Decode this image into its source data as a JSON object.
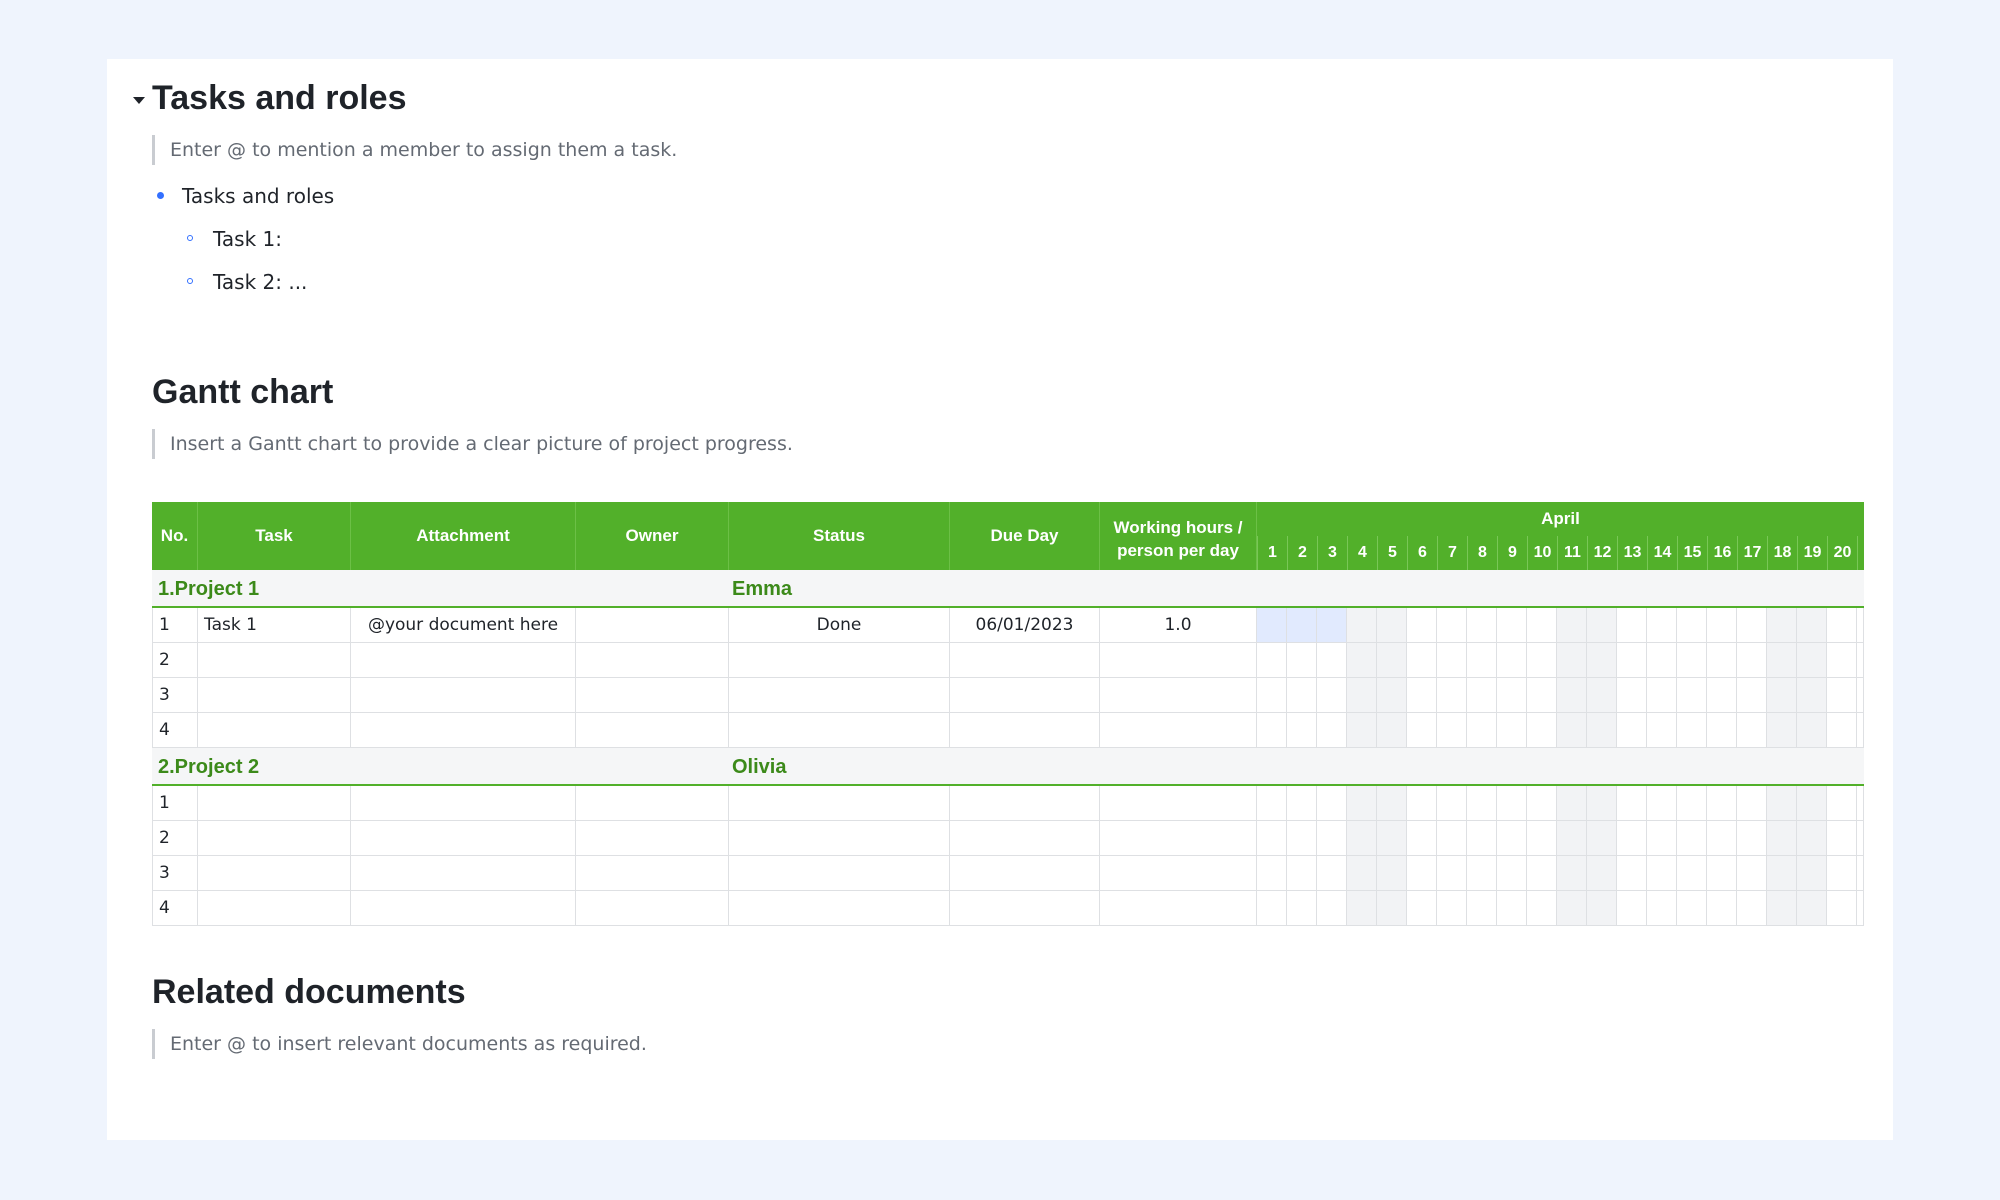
{
  "sections": {
    "tasks": {
      "title": "Tasks and roles",
      "hint": "Enter @ to mention a member to assign them a task.",
      "bullet": "Tasks and roles",
      "subitems": [
        "Task 1:",
        "Task 2: ..."
      ]
    },
    "gantt": {
      "title": "Gantt chart",
      "hint": "Insert a Gantt chart to provide a clear picture of project progress."
    },
    "related": {
      "title": "Related documents",
      "hint": "Enter @ to insert relevant documents as required."
    }
  },
  "table": {
    "headers": {
      "no": "No.",
      "task": "Task",
      "attachment": "Attachment",
      "owner": "Owner",
      "status": "Status",
      "due": "Due Day",
      "hours_line1": "Working hours /",
      "hours_line2": "person per day"
    },
    "month": "April",
    "days": [
      "1",
      "2",
      "3",
      "4",
      "5",
      "6",
      "7",
      "8",
      "9",
      "10",
      "11",
      "12",
      "13",
      "14",
      "15",
      "16",
      "17",
      "18",
      "19",
      "20"
    ],
    "weekend_days": [
      4,
      5,
      11,
      12,
      18,
      19
    ],
    "groups": [
      {
        "label": "1.Project 1",
        "owner": "Emma",
        "rows": [
          {
            "no": "1",
            "task": "Task 1",
            "attachment": "@your document here",
            "owner": "",
            "status": "Done",
            "due": "06/01/2023",
            "hours": "1.0",
            "bar_days": [
              1,
              2,
              3
            ]
          },
          {
            "no": "2",
            "task": "",
            "attachment": "",
            "owner": "",
            "status": "",
            "due": "",
            "hours": "",
            "bar_days": []
          },
          {
            "no": "3",
            "task": "",
            "attachment": "",
            "owner": "",
            "status": "",
            "due": "",
            "hours": "",
            "bar_days": []
          },
          {
            "no": "4",
            "task": "",
            "attachment": "",
            "owner": "",
            "status": "",
            "due": "",
            "hours": "",
            "bar_days": []
          }
        ]
      },
      {
        "label": "2.Project 2",
        "owner": "Olivia",
        "rows": [
          {
            "no": "1",
            "task": "",
            "attachment": "",
            "owner": "",
            "status": "",
            "due": "",
            "hours": "",
            "bar_days": []
          },
          {
            "no": "2",
            "task": "",
            "attachment": "",
            "owner": "",
            "status": "",
            "due": "",
            "hours": "",
            "bar_days": []
          },
          {
            "no": "3",
            "task": "",
            "attachment": "",
            "owner": "",
            "status": "",
            "due": "",
            "hours": "",
            "bar_days": []
          },
          {
            "no": "4",
            "task": "",
            "attachment": "",
            "owner": "",
            "status": "",
            "due": "",
            "hours": "",
            "bar_days": []
          }
        ]
      }
    ]
  },
  "colors": {
    "header_green": "#52b02a",
    "group_text": "#3c8a1a",
    "bar_fill": "#e1eafe",
    "page_bg": "#eff4fd",
    "bullet_blue": "#3370ff"
  }
}
